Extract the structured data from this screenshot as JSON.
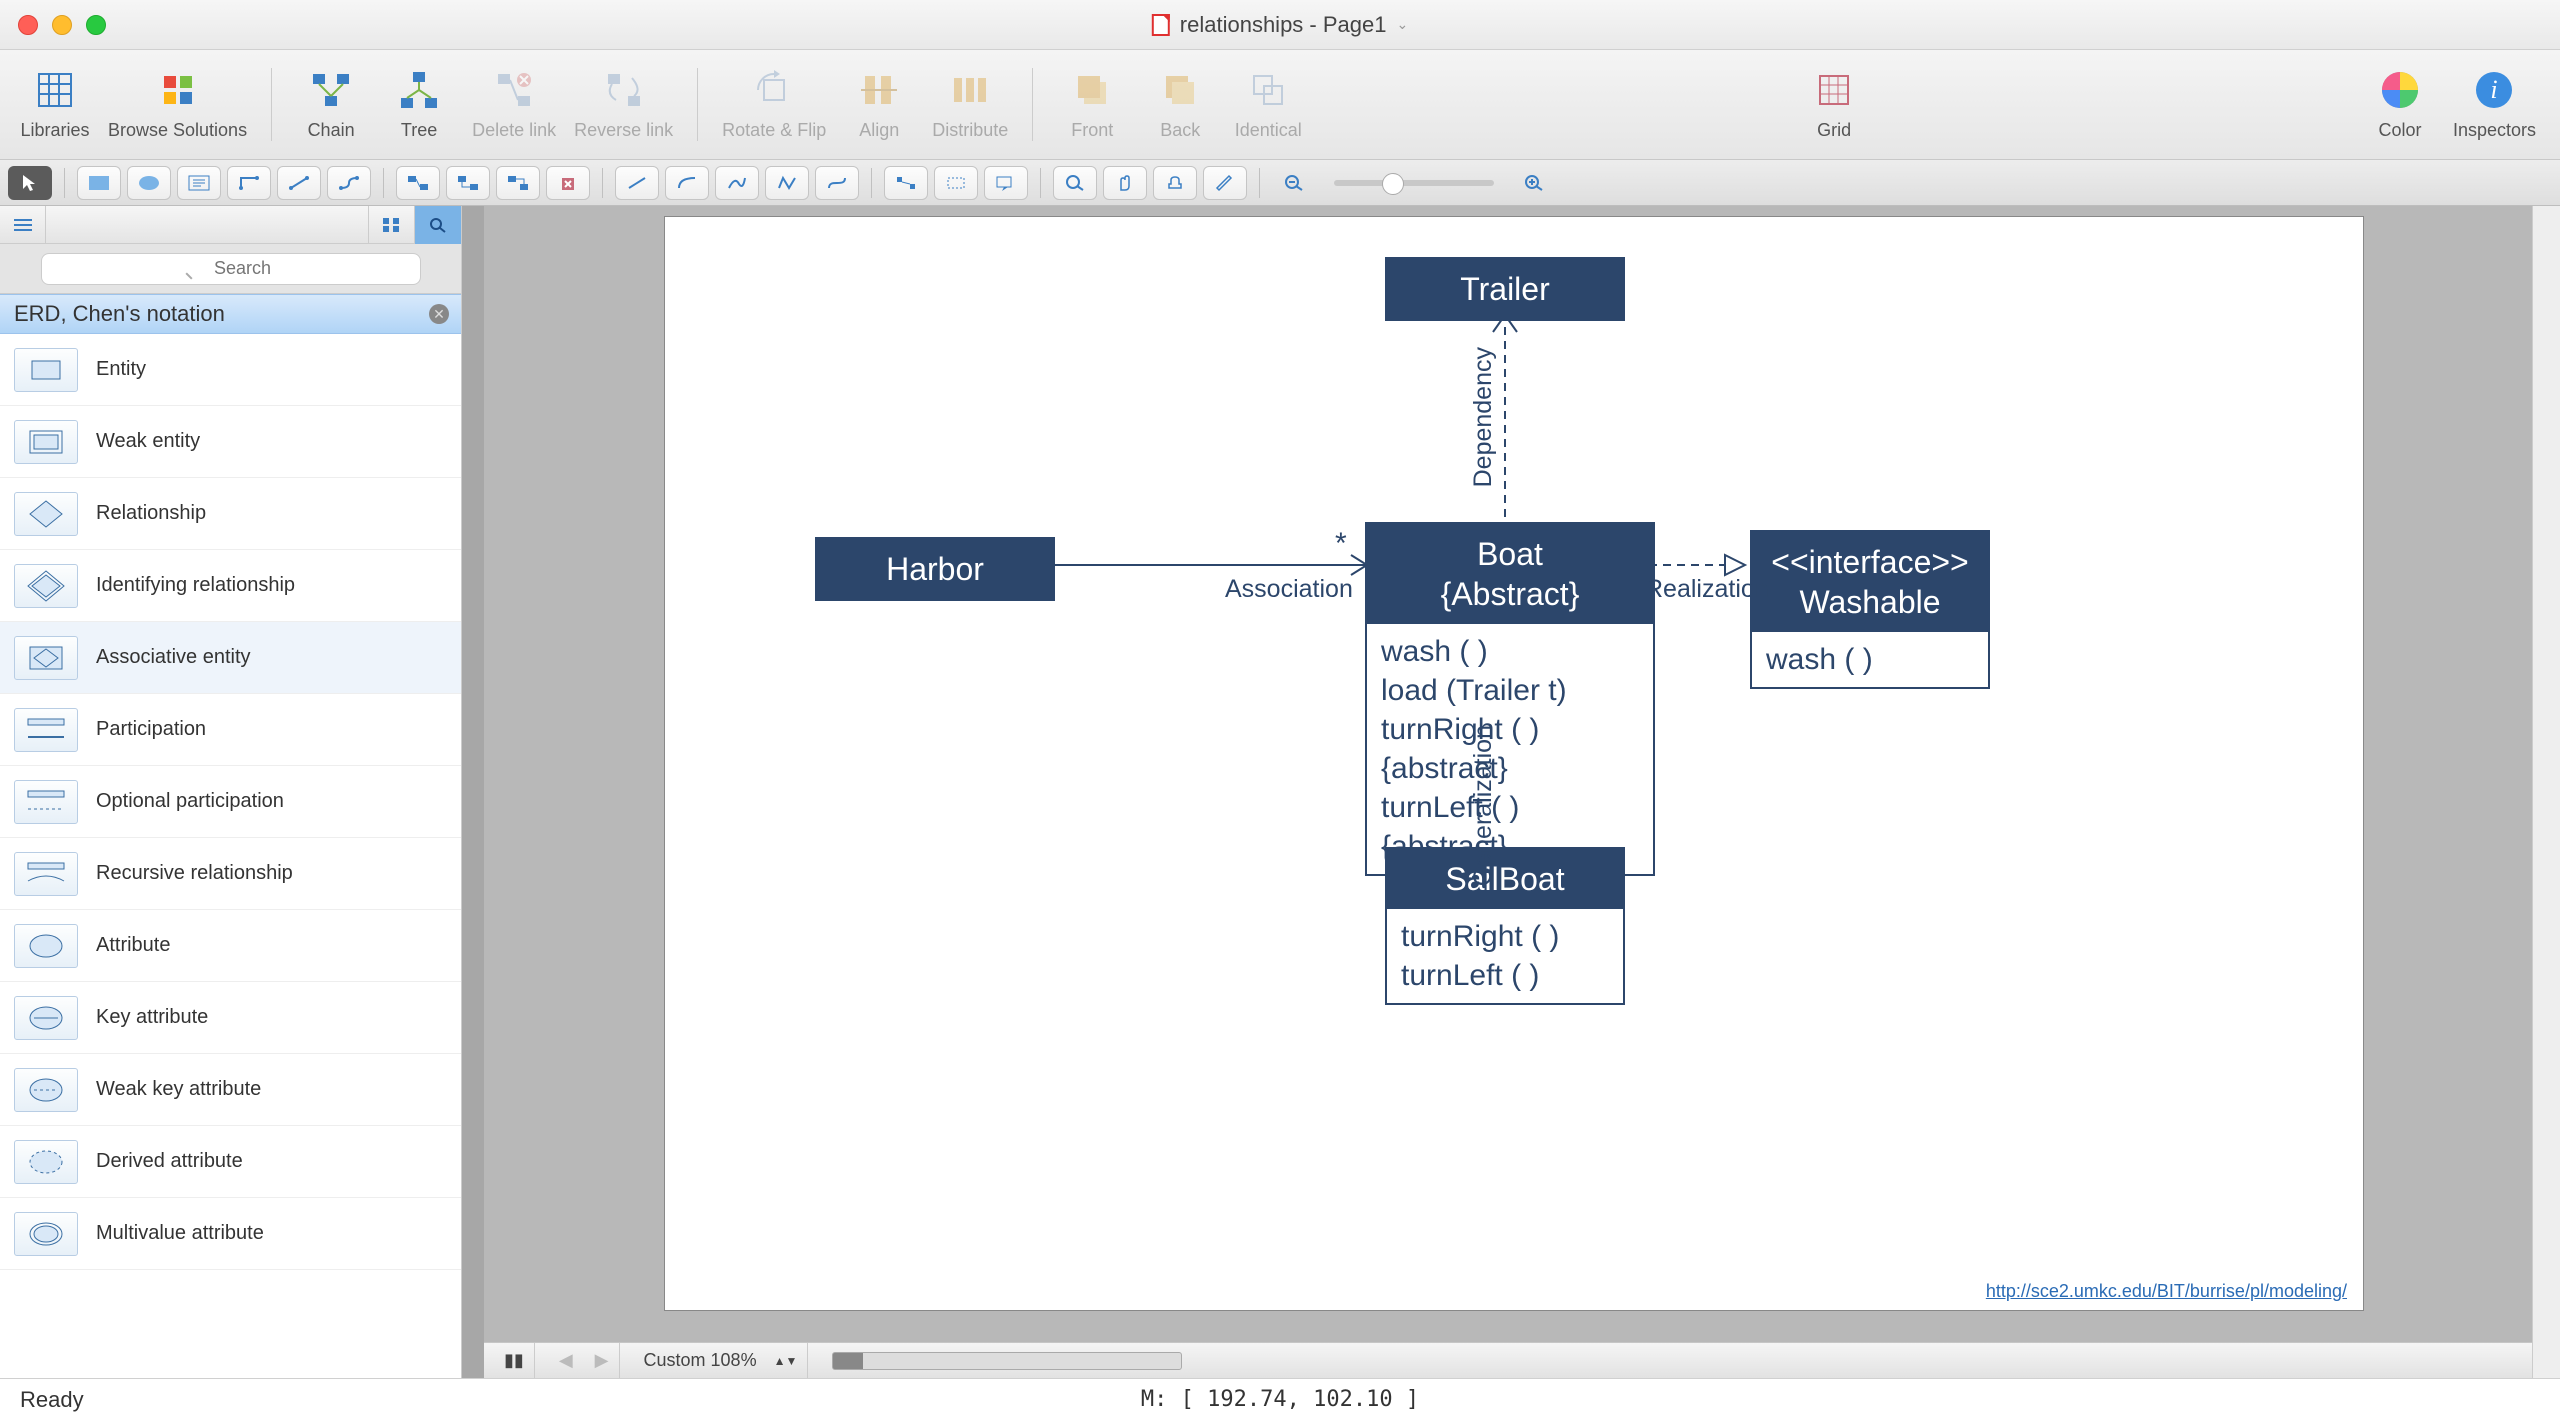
{
  "window_title": "relationships - Page1",
  "toolbar": {
    "libraries": "Libraries",
    "browse": "Browse Solutions",
    "chain": "Chain",
    "tree": "Tree",
    "delete_link": "Delete link",
    "reverse_link": "Reverse link",
    "rotate_flip": "Rotate & Flip",
    "align": "Align",
    "distribute": "Distribute",
    "front": "Front",
    "back": "Back",
    "identical": "Identical",
    "grid": "Grid",
    "color": "Color",
    "inspectors": "Inspectors"
  },
  "sidebar": {
    "search_placeholder": "Search",
    "panel_title": "ERD, Chen's notation",
    "items": [
      {
        "label": "Entity"
      },
      {
        "label": "Weak entity"
      },
      {
        "label": "Relationship"
      },
      {
        "label": "Identifying relationship"
      },
      {
        "label": "Associative entity"
      },
      {
        "label": "Participation"
      },
      {
        "label": "Optional participation"
      },
      {
        "label": "Recursive relationship"
      },
      {
        "label": "Attribute"
      },
      {
        "label": "Key attribute"
      },
      {
        "label": "Weak key attribute"
      },
      {
        "label": "Derived attribute"
      },
      {
        "label": "Multivalue attribute"
      }
    ]
  },
  "diagram": {
    "trailer": "Trailer",
    "harbor": "Harbor",
    "boat_title": "Boat",
    "boat_sub": "{Abstract}",
    "boat_ops": [
      "wash ( )",
      "load (Trailer t)",
      "turnRight ( ) {abstract}",
      "turnLeft ( ) {abstract}"
    ],
    "interface_s": "<<interface>>",
    "interface_name": "Washable",
    "interface_ops": [
      "wash ( )"
    ],
    "sailboat": "SailBoat",
    "sailboat_ops": [
      "turnRight ( )",
      "turnLeft ( )"
    ],
    "rel_dependency": "Dependency",
    "rel_association": "Association",
    "rel_realization": "Realization",
    "rel_generalization": "Generalization",
    "star": "*",
    "link": "http://sce2.umkc.edu/BIT/burrise/pl/modeling/"
  },
  "bottom": {
    "zoom": "Custom 108%"
  },
  "status": {
    "ready": "Ready",
    "mouse": "M: [ 192.74, 102.10 ]"
  }
}
